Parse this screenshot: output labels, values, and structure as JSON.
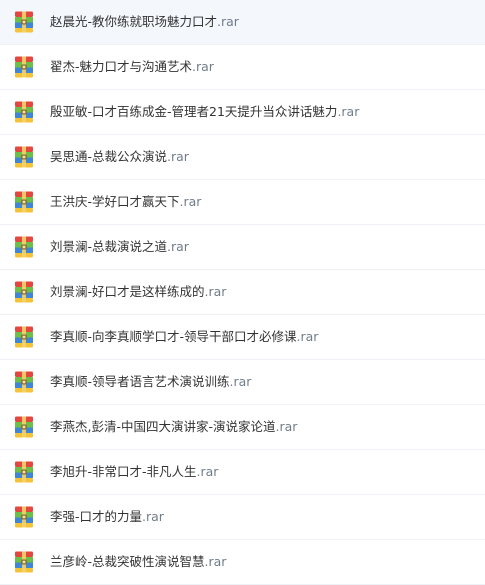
{
  "file_list": {
    "selected_index": 0,
    "items": [
      {
        "base": "赵晨光-教你练就职场魅力口才",
        "ext": ".rar",
        "icon": "rar-archive-icon"
      },
      {
        "base": "翟杰-魅力口才与沟通艺术",
        "ext": ".rar",
        "icon": "rar-archive-icon"
      },
      {
        "base": "殷亚敏-口才百练成金-管理者21天提升当众讲话魅力",
        "ext": ".rar",
        "icon": "rar-archive-icon"
      },
      {
        "base": "吴思通-总裁公众演说",
        "ext": ".rar",
        "icon": "rar-archive-icon"
      },
      {
        "base": "王洪庆-学好口才赢天下",
        "ext": ".rar",
        "icon": "rar-archive-icon"
      },
      {
        "base": "刘景澜-总裁演说之道",
        "ext": ".rar",
        "icon": "rar-archive-icon"
      },
      {
        "base": "刘景澜-好口才是这样练成的",
        "ext": ".rar",
        "icon": "rar-archive-icon"
      },
      {
        "base": "李真顺-向李真顺学口才-领导干部口才必修课",
        "ext": ".rar",
        "icon": "rar-archive-icon"
      },
      {
        "base": "李真顺-领导者语言艺术演说训练",
        "ext": ".rar",
        "icon": "rar-archive-icon"
      },
      {
        "base": "李燕杰,彭清-中国四大演讲家-演说家论道",
        "ext": ".rar",
        "icon": "rar-archive-icon"
      },
      {
        "base": "李旭升-非常口才-非凡人生",
        "ext": ".rar",
        "icon": "rar-archive-icon"
      },
      {
        "base": "李强-口才的力量",
        "ext": ".rar",
        "icon": "rar-archive-icon"
      },
      {
        "base": "兰彦岭-总裁突破性演说智慧",
        "ext": ".rar",
        "icon": "rar-archive-icon"
      }
    ]
  },
  "colors": {
    "text": "#333333",
    "ext_text": "#727d8a",
    "row_divider": "#eef1f6",
    "selected_row": "#f4f8fd",
    "icon_red": "#e2483f",
    "icon_green": "#6cc04a",
    "icon_blue": "#3f86d4",
    "icon_yellow": "#f5c338"
  }
}
